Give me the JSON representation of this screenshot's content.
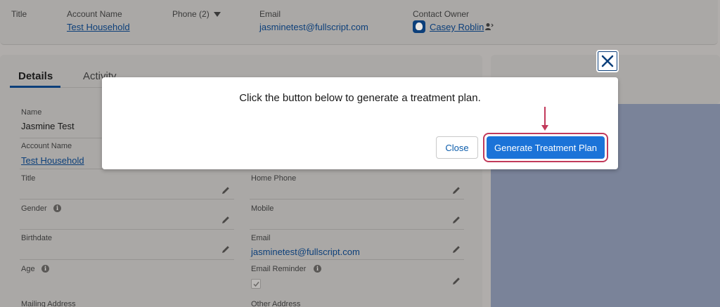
{
  "header": {
    "title_label": "Title",
    "account_name_label": "Account Name",
    "account_name_value": "Test Household",
    "phone_label": "Phone (2)",
    "email_label": "Email",
    "email_value": "jasminetest@fullscript.com",
    "contact_owner_label": "Contact Owner",
    "contact_owner_value": "Casey Roblin"
  },
  "tabs": [
    {
      "label": "Details"
    },
    {
      "label": "Activity"
    }
  ],
  "details": {
    "name_label": "Name",
    "name_value": "Jasmine Test",
    "account_name_label": "Account Name",
    "account_name_value": "Test Household",
    "title_label": "Title",
    "home_phone_label": "Home Phone",
    "gender_label": "Gender",
    "mobile_label": "Mobile",
    "birthdate_label": "Birthdate",
    "email_label": "Email",
    "email_value": "jasminetest@fullscript.com",
    "age_label": "Age",
    "email_reminder_label": "Email Reminder",
    "email_reminder_checked": true,
    "mailing_address_label": "Mailing Address",
    "other_address_label": "Other Address"
  },
  "modal": {
    "message": "Click the button below to generate a treatment plan.",
    "close_label": "Close",
    "generate_label": "Generate Treatment Plan"
  },
  "colors": {
    "brand_blue": "#1b73d8",
    "highlight": "#c23a5b",
    "link": "#0c3f7a"
  }
}
